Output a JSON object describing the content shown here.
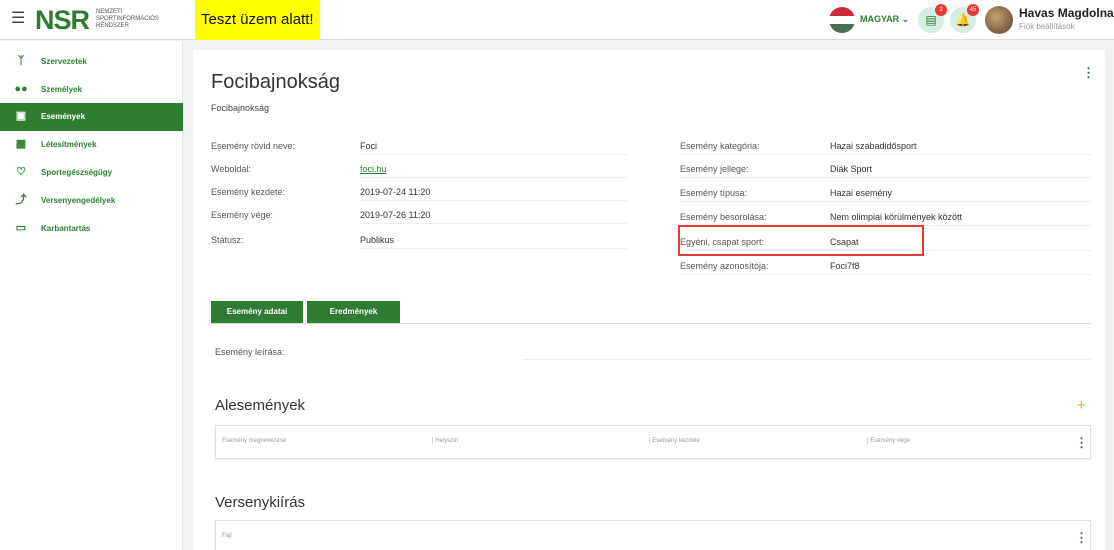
{
  "header": {
    "logo": "NSR",
    "logo_sub": "Nemzeti Sportinformációs Rendszer",
    "test_banner": "Teszt üzem alatt!",
    "language": "MAGYAR ⌄",
    "documents_badge": "2",
    "notifications_badge": "45",
    "user_name": "Havas Magdolna",
    "user_sub": "Fiók beállítások",
    "flag_colors": [
      "#ce2939",
      "#ffffff",
      "#477050"
    ]
  },
  "sidebar": {
    "items": [
      {
        "label": "Szervezetek",
        "icon": "org-icon"
      },
      {
        "label": "Személyek",
        "icon": "people-icon"
      },
      {
        "label": "Események",
        "icon": "calendar-icon"
      },
      {
        "label": "Létesítmények",
        "icon": "building-icon"
      },
      {
        "label": "Sportegészségügy",
        "icon": "heart-icon"
      },
      {
        "label": "Versenyengedélyek",
        "icon": "runner-icon"
      },
      {
        "label": "Karbantartás",
        "icon": "clipboard-icon"
      }
    ],
    "active": "Események"
  },
  "main": {
    "title": "Focibajnokság",
    "subtitle": "Focibajnokság",
    "left_fields": [
      {
        "label": "Esemény rövid neve:",
        "value": "Foci"
      },
      {
        "label": "Weboldal:",
        "value": "foci.hu"
      },
      {
        "label": "Esemény kezdete:",
        "value": "2019-07-24 11:20"
      },
      {
        "label": "Esemény vége:",
        "value": "2019-07-26 11:20"
      },
      {
        "label": "Státusz:",
        "value": "Publikus"
      }
    ],
    "right_fields": [
      {
        "label": "Esemény kategória:",
        "value": "Hazai szabadidősport"
      },
      {
        "label": "Esemény jellege:",
        "value": "Diák Sport"
      },
      {
        "label": "Esemény típusa:",
        "value": "Hazai esemény"
      },
      {
        "label": "Esemény besorolása:",
        "value": "Nem olimpiai körülmények között"
      },
      {
        "label": "Egyéni, csapat sport:",
        "value": "Csapat"
      },
      {
        "label": "Esemény azonosítója:",
        "value": "Foci7f8"
      }
    ],
    "tabs": [
      "Esemény adatai",
      "Eredmények"
    ],
    "description_label": "Esemény leírása:",
    "subevents": {
      "title": "Alesemények",
      "columns": [
        "Esemény megnevezése",
        "| Helyszín",
        "| Esemény kezdete",
        "| Esemény vége"
      ]
    },
    "competition": {
      "title": "Versenykiírás",
      "columns": [
        "Fájl"
      ]
    },
    "accent": "#2e7d32",
    "highlight_color": "#e53935"
  }
}
